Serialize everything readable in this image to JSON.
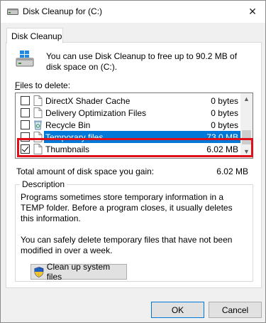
{
  "window": {
    "title": "Disk Cleanup for  (C:)",
    "close_glyph": "✕"
  },
  "tabs": [
    {
      "label": "Disk Cleanup"
    }
  ],
  "intro": {
    "text": "You can use Disk Cleanup to free up to 90.2 MB of disk space on  (C:)."
  },
  "files_to_delete": {
    "label_underlined": "F",
    "label_rest": "iles to delete:",
    "items": [
      {
        "name": "DirectX Shader Cache",
        "size": "0 bytes",
        "checked": false,
        "icon": "blank-file-icon"
      },
      {
        "name": "Delivery Optimization Files",
        "size": "0 bytes",
        "checked": false,
        "icon": "blank-file-icon"
      },
      {
        "name": "Recycle Bin",
        "size": "0 bytes",
        "checked": false,
        "icon": "recycle-bin-icon"
      },
      {
        "name": "Temporary files",
        "size": "73.0 MB",
        "checked": false,
        "selected": true,
        "icon": "blank-file-icon"
      },
      {
        "name": "Thumbnails",
        "size": "6.02 MB",
        "checked": true,
        "icon": "blank-file-icon"
      }
    ]
  },
  "total": {
    "label": "Total amount of disk space you gain:",
    "value": "6.02 MB"
  },
  "description": {
    "legend": "Description",
    "para1": "Programs sometimes store temporary information in a TEMP folder. Before a program closes, it usually deletes this information.",
    "para2": "You can safely delete temporary files that have not been modified in over a week."
  },
  "buttons": {
    "system_files": "Clean up system files",
    "ok": "OK",
    "cancel": "Cancel"
  },
  "colors": {
    "selection": "#0078d7",
    "highlight_box": "#e0101b"
  }
}
